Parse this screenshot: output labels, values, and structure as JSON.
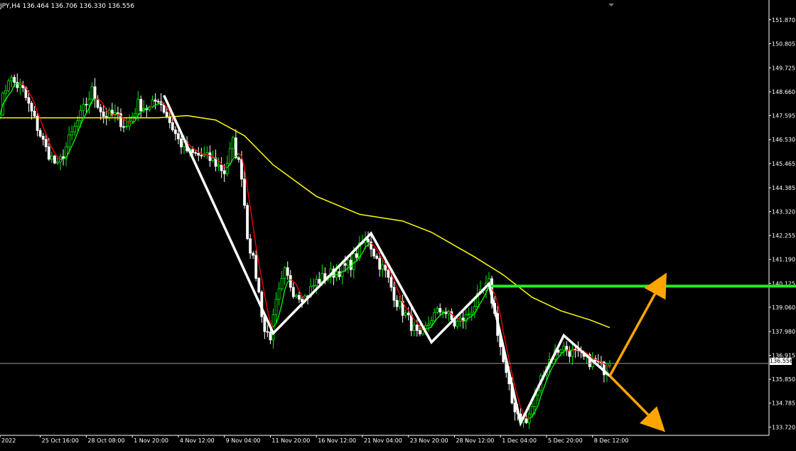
{
  "header": {
    "symbol_text": "JPY,H4  136.464 136.706 136.330 136.556"
  },
  "current_price_label": "136.556",
  "chart_data": {
    "type": "candlestick",
    "title": "",
    "xlabel": "",
    "ylabel": "",
    "symbol": "JPY",
    "timeframe": "H4",
    "ohlc": {
      "open": 136.464,
      "high": 136.706,
      "low": 136.33,
      "close": 136.556
    },
    "ylim": [
      133.35,
      152.75
    ],
    "y_ticks": [
      "151.870",
      "150.805",
      "149.725",
      "148.660",
      "147.595",
      "146.530",
      "145.465",
      "144.385",
      "143.320",
      "142.255",
      "141.190",
      "140.125",
      "139.060",
      "137.980",
      "136.915",
      "135.850",
      "134.785",
      "133.720"
    ],
    "x_ticks": [
      "2022",
      "25 Oct 16:00",
      "28 Oct 08:00",
      "1 Nov 20:00",
      "4 Nov 12:00",
      "9 Nov 04:00",
      "11 Nov 20:00",
      "16 Nov 12:00",
      "21 Nov 04:00",
      "23 Nov 20:00",
      "28 Nov 12:00",
      "1 Dec 04:00",
      "5 Dec 20:00",
      "8 Dec 12:00"
    ],
    "x_tick_bars": [
      0,
      14,
      30,
      46,
      62,
      78,
      94,
      110,
      126,
      142,
      158,
      174,
      190,
      206
    ],
    "bar_count": 213,
    "current_price": 136.556,
    "price_path": [
      [
        0,
        147.9
      ],
      [
        3,
        149.3
      ],
      [
        8,
        148.7
      ],
      [
        12,
        147.4
      ],
      [
        16,
        146.1
      ],
      [
        20,
        145.3
      ],
      [
        24,
        146.5
      ],
      [
        28,
        147.6
      ],
      [
        32,
        148.7
      ],
      [
        36,
        147.6
      ],
      [
        40,
        147.6
      ],
      [
        44,
        147.1
      ],
      [
        48,
        148.1
      ],
      [
        52,
        147.9
      ],
      [
        55,
        148.4
      ],
      [
        58,
        147.6
      ],
      [
        62,
        146.5
      ],
      [
        66,
        145.9
      ],
      [
        70,
        145.8
      ],
      [
        74,
        145.6
      ],
      [
        78,
        145.1
      ],
      [
        81,
        146.4
      ],
      [
        84,
        145.0
      ],
      [
        86,
        142.3
      ],
      [
        89,
        140.5
      ],
      [
        92,
        138.0
      ],
      [
        94,
        137.8
      ],
      [
        96,
        139.2
      ],
      [
        99,
        140.6
      ],
      [
        102,
        139.8
      ],
      [
        106,
        139.5
      ],
      [
        110,
        140.2
      ],
      [
        114,
        140.5
      ],
      [
        118,
        140.7
      ],
      [
        122,
        141.0
      ],
      [
        126,
        141.9
      ],
      [
        128,
        142.1
      ],
      [
        131,
        141.2
      ],
      [
        134,
        140.6
      ],
      [
        138,
        139.3
      ],
      [
        142,
        138.5
      ],
      [
        146,
        137.6
      ],
      [
        150,
        138.6
      ],
      [
        154,
        139.0
      ],
      [
        158,
        138.3
      ],
      [
        162,
        138.6
      ],
      [
        166,
        139.4
      ],
      [
        170,
        140.1
      ],
      [
        172,
        138.7
      ],
      [
        175,
        136.6
      ],
      [
        178,
        134.8
      ],
      [
        181,
        134.1
      ],
      [
        183,
        133.9
      ],
      [
        186,
        135.0
      ],
      [
        189,
        136.3
      ],
      [
        192,
        136.9
      ],
      [
        195,
        137.3
      ],
      [
        198,
        137.1
      ],
      [
        201,
        136.9
      ],
      [
        204,
        136.7
      ],
      [
        207,
        136.6
      ],
      [
        210,
        136.3
      ],
      [
        212,
        136.556
      ]
    ],
    "series": [
      {
        "name": "",
        "kind": "moving_average_slow",
        "color": "#ffff00",
        "points": [
          [
            0,
            147.5
          ],
          [
            30,
            147.5
          ],
          [
            55,
            147.5
          ],
          [
            65,
            147.6
          ],
          [
            75,
            147.4
          ],
          [
            85,
            146.7
          ],
          [
            95,
            145.4
          ],
          [
            110,
            144.0
          ],
          [
            125,
            143.2
          ],
          [
            140,
            142.9
          ],
          [
            150,
            142.4
          ],
          [
            165,
            141.3
          ],
          [
            175,
            140.5
          ],
          [
            185,
            139.5
          ],
          [
            195,
            138.9
          ],
          [
            205,
            138.5
          ],
          [
            212,
            138.15
          ]
        ]
      },
      {
        "name": "",
        "kind": "moving_average_fast",
        "color": "#ff0000",
        "color_rising": "#00ff00"
      }
    ],
    "zigzag": {
      "color": "#ffffff",
      "points": [
        [
          57,
          148.5
        ],
        [
          95,
          137.9
        ],
        [
          129,
          142.35
        ],
        [
          150,
          137.5
        ],
        [
          170,
          140.1
        ],
        [
          181,
          133.9
        ],
        [
          196,
          137.8
        ],
        [
          212,
          136.0
        ]
      ]
    },
    "resistance_line": {
      "price": 140.0,
      "color": "#22ee22",
      "start_bar": 170
    },
    "projection_arrows": {
      "color": "#ffa500",
      "up": {
        "from": [
          212,
          136.0
        ],
        "to_price": 140.6
      },
      "down": {
        "from": [
          212,
          136.0
        ],
        "to_price": 133.5
      }
    },
    "colors": {
      "bull_candle": "#00ee00",
      "bear_candle": "#ffffff",
      "axis": "#ffffff",
      "current_price_line": "#9a9a9a"
    },
    "grid": false,
    "legend": "none"
  }
}
